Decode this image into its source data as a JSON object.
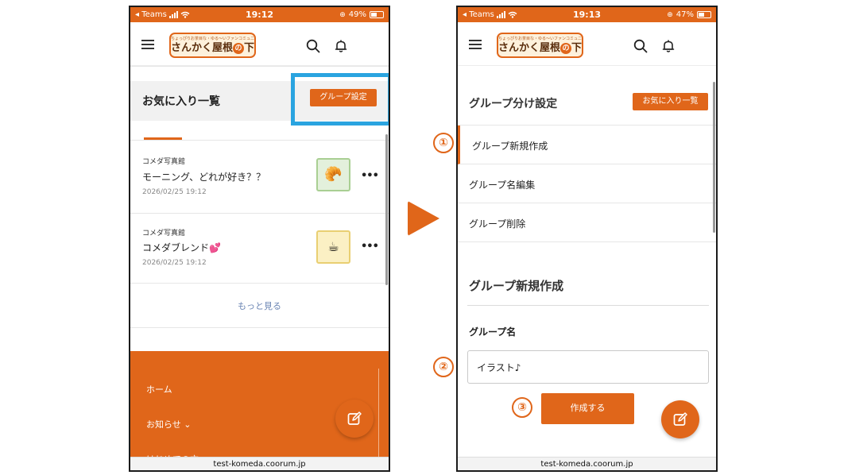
{
  "left": {
    "status": {
      "carrier": "◂ Teams",
      "time": "19:12",
      "battery": "49%",
      "battery_level": 0.49
    },
    "logo": {
      "tagline": "ちょっぴりお茶目な・ゆる〜いファンコミュニティ",
      "main": "さんかく屋根",
      "badge": "の",
      "suffix": "下"
    },
    "favorites_title": "お気に入り一覧",
    "group_settings_button": "グループ設定",
    "posts": [
      {
        "category": "コメダ写真館",
        "title": "モーニング、どれが好き？？",
        "date": "2026/02/25 19:12",
        "thumb_icon": "🥐"
      },
      {
        "category": "コメダ写真館",
        "title": "コメダブレンド💕",
        "date": "2026/02/25 19:12",
        "thumb_icon": "☕"
      }
    ],
    "more_link": "もっと見る",
    "footer_nav": [
      "ホーム",
      "お知らせ ⌄",
      "はじめての方へ"
    ],
    "url": "test-komeda.coorum.jp"
  },
  "right": {
    "status": {
      "carrier": "◂ Teams",
      "time": "19:13",
      "battery": "47%",
      "battery_level": 0.47
    },
    "logo": {
      "tagline": "ちょっぴりお茶目な・ゆる〜いファンコミュニティ",
      "main": "さんかく屋根",
      "badge": "の",
      "suffix": "下"
    },
    "section_title": "グループ分け設定",
    "favorites_button": "お気に入り一覧",
    "menu": [
      "グループ新規作成",
      "グループ名編集",
      "グループ削除"
    ],
    "form_title": "グループ新規作成",
    "field_label": "グループ名",
    "field_value": "イラスト♪",
    "submit_button": "作成する",
    "url": "test-komeda.coorum.jp"
  },
  "markers": [
    "①",
    "②",
    "③"
  ],
  "colors": {
    "accent": "#e0661a",
    "highlight": "#2aa4e0",
    "link": "#6c86b4"
  }
}
